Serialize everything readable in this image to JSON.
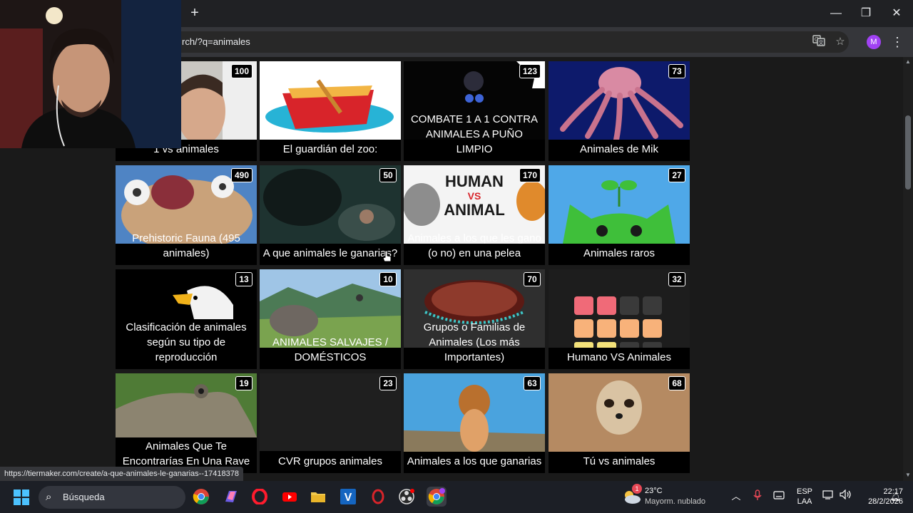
{
  "browser": {
    "new_tab_label": "+",
    "minimize": "—",
    "restore": "❐",
    "close": "✕",
    "url": "rch/?q=animales",
    "profile_initial": "M",
    "status_url": "https://tiermaker.com/create/a-que-animales-le-ganarias--17418378"
  },
  "cards": [
    {
      "caption": "1 vs animales",
      "count": "100"
    },
    {
      "caption": "El guardián del zoo:",
      "count": ""
    },
    {
      "caption": "COMBATE 1 A 1 CONTRA ANIMALES A PUÑO LIMPIO",
      "count": "123"
    },
    {
      "caption": "Animales de Mik",
      "count": "73"
    },
    {
      "caption": "Prehistoric Fauna (495 animales)",
      "count": "490"
    },
    {
      "caption": "A que animales le ganarias?",
      "count": "50"
    },
    {
      "caption": "Animales a los que les gano (o no) en una pelea",
      "count": "170",
      "thumb_text_top": "HUMAN",
      "thumb_text_mid": "VS",
      "thumb_text_bottom": "ANIMAL"
    },
    {
      "caption": "Animales raros",
      "count": "27"
    },
    {
      "caption": "Clasificación de animales según su tipo de reproducción",
      "count": "13"
    },
    {
      "caption": "ANIMALES SALVAJES / DOMÉSTICOS",
      "count": "10"
    },
    {
      "caption": "Grupos o Familias de Animales (Los más Importantes)",
      "count": "70"
    },
    {
      "caption": "Humano VS Animales",
      "count": "32"
    },
    {
      "caption": "Animales Que Te Encontrarías En Una Rave",
      "count": "19"
    },
    {
      "caption": "CVR grupos animales",
      "count": "23"
    },
    {
      "caption": "Animales a los que ganarias",
      "count": "63"
    },
    {
      "caption": "Tú vs animales",
      "count": "68"
    }
  ],
  "taskbar": {
    "search_placeholder": "Búsqueda",
    "weather_temp": "23°C",
    "weather_desc": "Mayorm. nublado",
    "weather_badge": "1",
    "lang_top": "ESP",
    "lang_bottom": "LAA",
    "time": "22:17",
    "date": "28/2/2026",
    "youtube_badge": "1"
  },
  "icons": {
    "translate": "translate-icon",
    "bookmark": "star-icon",
    "menu": "kebab-menu-icon"
  }
}
